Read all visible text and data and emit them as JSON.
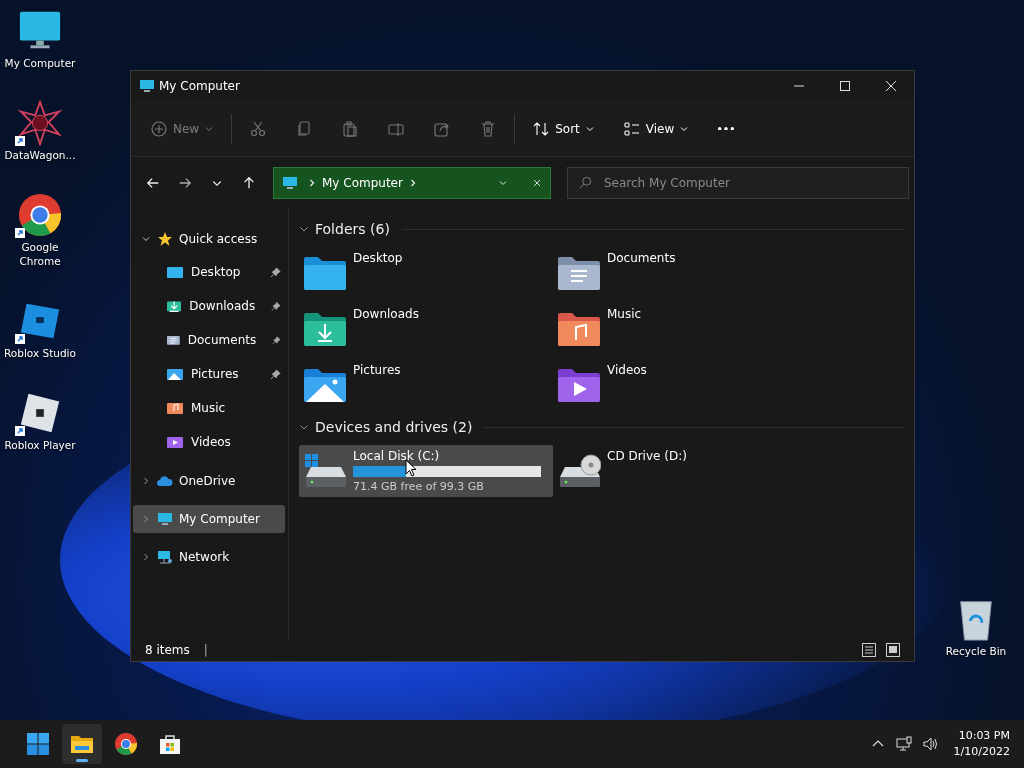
{
  "desktop_icons": [
    {
      "label": "My Computer",
      "kind": "computer",
      "shortcut": false
    },
    {
      "label": "DataWagon...",
      "kind": "star",
      "shortcut": true
    },
    {
      "label": "Google Chrome",
      "kind": "chrome",
      "shortcut": true
    },
    {
      "label": "Roblox Studio",
      "kind": "studio",
      "shortcut": true
    },
    {
      "label": "Roblox Player",
      "kind": "player",
      "shortcut": true
    }
  ],
  "recycle_bin": {
    "label": "Recycle Bin"
  },
  "window": {
    "title": "My Computer"
  },
  "toolbar": {
    "items": [
      {
        "kind": "new",
        "label": "New",
        "disabled": true
      },
      {
        "kind": "cut",
        "disabled": true
      },
      {
        "kind": "copy",
        "disabled": true
      },
      {
        "kind": "paste",
        "disabled": true
      },
      {
        "kind": "rename",
        "disabled": true
      },
      {
        "kind": "share",
        "disabled": true
      },
      {
        "kind": "delete",
        "disabled": true
      },
      {
        "kind": "sort",
        "label": "Sort",
        "disabled": false
      },
      {
        "kind": "view",
        "label": "View",
        "disabled": false
      },
      {
        "kind": "more",
        "disabled": false
      }
    ]
  },
  "address": {
    "location": "My Computer"
  },
  "search": {
    "placeholder": "Search My Computer"
  },
  "sidebar": {
    "items": [
      {
        "label": "Quick access",
        "kind": "star",
        "expanded": true,
        "selected": false,
        "children": [
          {
            "label": "Desktop",
            "kind": "desktop",
            "pinned": true,
            "selected": false
          },
          {
            "label": "Downloads",
            "kind": "downloads",
            "pinned": true,
            "selected": false
          },
          {
            "label": "Documents",
            "kind": "documents",
            "pinned": true,
            "selected": false
          },
          {
            "label": "Pictures",
            "kind": "pictures",
            "pinned": true,
            "selected": false
          },
          {
            "label": "Music",
            "kind": "music",
            "pinned": false,
            "selected": false
          },
          {
            "label": "Videos",
            "kind": "videos",
            "pinned": false,
            "selected": false
          }
        ]
      },
      {
        "label": "OneDrive",
        "kind": "cloud",
        "expanded": false,
        "selected": false
      },
      {
        "label": "My Computer",
        "kind": "computer",
        "expanded": false,
        "selected": true
      },
      {
        "label": "Network",
        "kind": "network",
        "expanded": false,
        "selected": false
      }
    ]
  },
  "sections": [
    {
      "title": "Folders (6)",
      "expanded": true,
      "items": [
        {
          "label": "Desktop",
          "kind": "desktop"
        },
        {
          "label": "Documents",
          "kind": "documents"
        },
        {
          "label": "Downloads",
          "kind": "downloads"
        },
        {
          "label": "Music",
          "kind": "music"
        },
        {
          "label": "Pictures",
          "kind": "pictures"
        },
        {
          "label": "Videos",
          "kind": "videos"
        }
      ]
    },
    {
      "title": "Devices and drives (2)",
      "expanded": true,
      "items": [
        {
          "label": "Local Disk (C:)",
          "kind": "disk",
          "selected": true,
          "level": 0.28,
          "detail": "71.4 GB free of 99.3 GB"
        },
        {
          "label": "CD Drive (D:)",
          "kind": "cd",
          "selected": false
        }
      ]
    }
  ],
  "status_bar": {
    "count": "8 items",
    "separator": "|"
  },
  "taskbar": {
    "apps": [
      {
        "kind": "start",
        "selected": false
      },
      {
        "kind": "explorer",
        "selected": true
      },
      {
        "kind": "chrome",
        "selected": false
      },
      {
        "kind": "store",
        "selected": false
      }
    ],
    "time": "10:03 PM",
    "date": "1/10/2022"
  }
}
